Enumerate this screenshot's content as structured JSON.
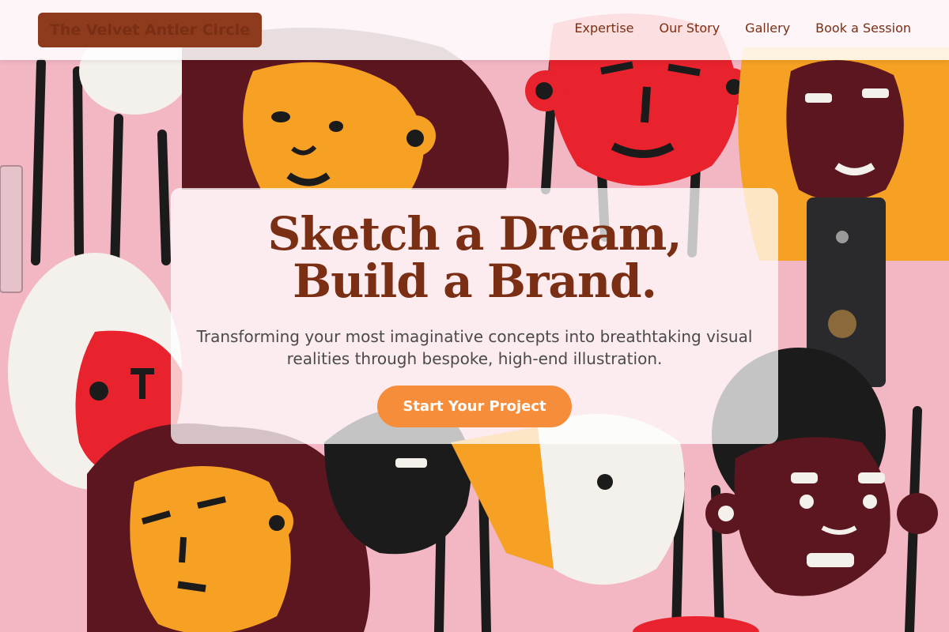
{
  "brand": {
    "name": "The Velvet Antler Circle"
  },
  "nav": {
    "items": [
      {
        "label": "Expertise"
      },
      {
        "label": "Our Story"
      },
      {
        "label": "Gallery"
      },
      {
        "label": "Book a Session"
      }
    ]
  },
  "hero": {
    "title": "Sketch a Dream, Build a Brand.",
    "subtitle": "Transforming your most imaginative concepts into breathtaking visual realities through bespoke, high-end illustration.",
    "cta_label": "Start Your Project"
  },
  "colors": {
    "brand_brown": "#7a2e14",
    "accent_orange": "#f68d3a",
    "mural_pink": "#f2b7c2",
    "mural_red": "#e8232d",
    "mural_orange": "#f6a024",
    "mural_maroon": "#5c1620"
  }
}
